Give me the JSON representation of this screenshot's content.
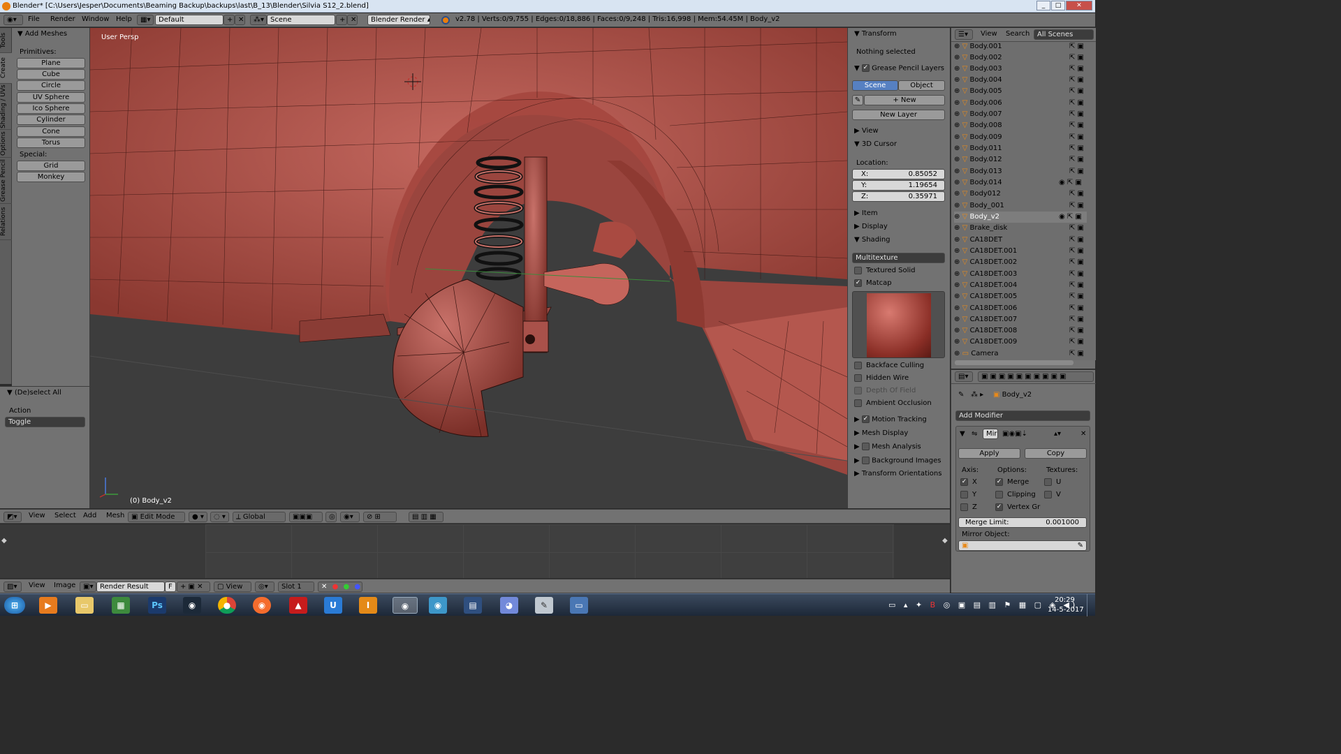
{
  "window": {
    "title": "Blender* [C:\\Users\\Jesper\\Documents\\Beaming Backup\\backups\\last\\B_13\\Blender\\Silvia S12_2.blend]"
  },
  "menubar": {
    "items": [
      "File",
      "Render",
      "Window",
      "Help"
    ],
    "layout": "Default",
    "scene": "Scene",
    "engine": "Blender Render",
    "stats": "v2.78 | Verts:0/9,755 | Edges:0/18,886 | Faces:0/9,248 | Tris:16,998 | Mem:54.45M | Body_v2"
  },
  "vtabs": [
    "Tools",
    "Create",
    "Shading / UVs",
    "Options",
    "Grease Pencil",
    "Relations"
  ],
  "toolshelf": {
    "header": "Add Meshes",
    "primitives_label": "Primitives:",
    "primitives": [
      "Plane",
      "Cube",
      "Circle",
      "UV Sphere",
      "Ico Sphere",
      "Cylinder",
      "Cone",
      "Torus"
    ],
    "special_label": "Special:",
    "special": [
      "Grid",
      "Monkey"
    ],
    "operator_header": "(De)select All",
    "action_label": "Action",
    "action_value": "Toggle"
  },
  "viewport": {
    "view_name": "User Persp",
    "object_label": "(0) Body_v2"
  },
  "viewport_header": {
    "items": [
      "View",
      "Select",
      "Add",
      "Mesh"
    ],
    "mode": "Edit Mode",
    "orientation": "Global"
  },
  "properties": {
    "transform": "Transform",
    "nothing_selected": "Nothing selected",
    "grease_pencil_layers": "Grease Pencil Layers",
    "scene_tab": "Scene",
    "object_tab": "Object",
    "new_btn": "New",
    "new_layer_btn": "New Layer",
    "view": "View",
    "cursor": "3D Cursor",
    "location": "Location:",
    "x_label": "X:",
    "x_value": "0.85052",
    "y_label": "Y:",
    "y_value": "1.19654",
    "z_label": "Z:",
    "z_value": "0.35971",
    "item": "Item",
    "display": "Display",
    "shading": "Shading",
    "shading_mode": "Multitexture",
    "textured_solid": "Textured Solid",
    "matcap": "Matcap",
    "backface_culling": "Backface Culling",
    "hidden_wire": "Hidden Wire",
    "depth_of_field": "Depth Of Field",
    "ambient_occlusion": "Ambient Occlusion",
    "motion_tracking": "Motion Tracking",
    "mesh_display": "Mesh Display",
    "mesh_analysis": "Mesh Analysis",
    "background_images": "Background Images",
    "transform_orientations": "Transform Orientations"
  },
  "outliner": {
    "header_view": "View",
    "header_search": "Search",
    "header_scope": "All Scenes",
    "items": [
      "Body.001",
      "Body.002",
      "Body.003",
      "Body.004",
      "Body.005",
      "Body.006",
      "Body.007",
      "Body.008",
      "Body.009",
      "Body.011",
      "Body.012",
      "Body.013",
      "Body.014",
      "Body012",
      "Body_001",
      "Body_v2",
      "Brake_disk",
      "CA18DET",
      "CA18DET.001",
      "CA18DET.002",
      "CA18DET.003",
      "CA18DET.004",
      "CA18DET.005",
      "CA18DET.006",
      "CA18DET.007",
      "CA18DET.008",
      "CA18DET.009",
      "Camera"
    ]
  },
  "modifier_panel": {
    "object_name": "Body_v2",
    "add_modifier": "Add Modifier",
    "modifier_name": "Mir",
    "apply": "Apply",
    "copy": "Copy",
    "axis_label": "Axis:",
    "options_label": "Options:",
    "textures_label": "Textures:",
    "x": "X",
    "y": "Y",
    "z": "Z",
    "merge": "Merge",
    "clipping": "Clipping",
    "vertex_gr": "Vertex Gr",
    "u": "U",
    "v": "V",
    "merge_limit_label": "Merge Limit:",
    "merge_limit_value": "0.001000",
    "mirror_object_label": "Mirror Object:"
  },
  "image_editor_header": {
    "view": "View",
    "image": "Image",
    "image_name": "Render Result",
    "f_label": "F",
    "view2": "View",
    "slot": "Slot 1"
  },
  "taskbar": {
    "time": "20:29",
    "date": "14-5-2017"
  }
}
